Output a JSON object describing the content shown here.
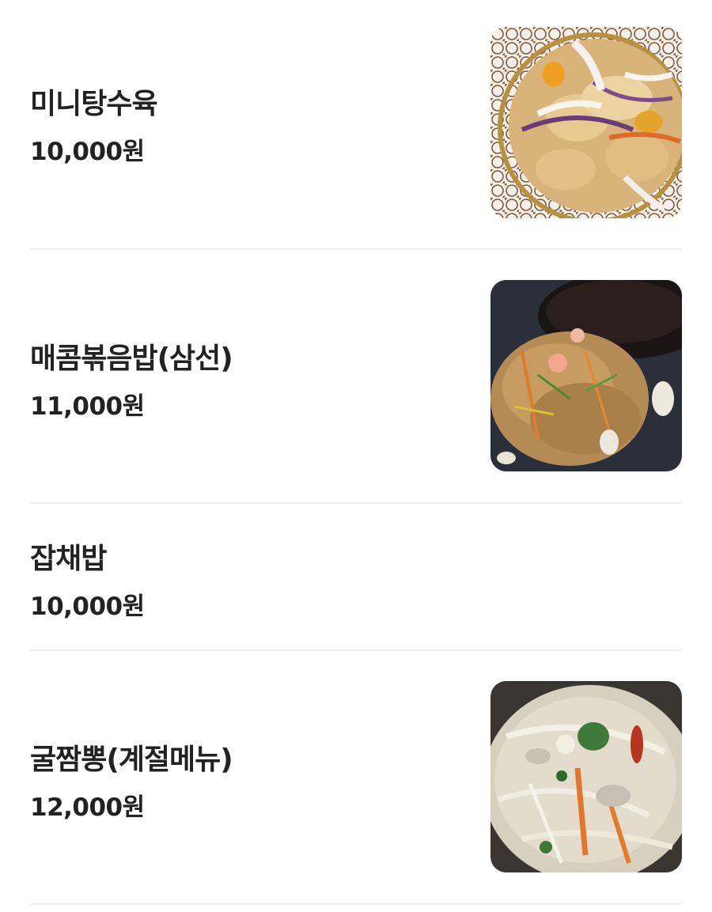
{
  "menu": {
    "items": [
      {
        "name": "미니탕수육",
        "price": "10,000원",
        "photo": "sweet-and-sour-pork-photo"
      },
      {
        "name": "매콤볶음밥(삼선)",
        "price": "11,000원",
        "photo": "spicy-fried-rice-photo"
      },
      {
        "name": "잡채밥",
        "price": "10,000원",
        "photo": null
      },
      {
        "name": "굴짬뽕(계절메뉴)",
        "price": "12,000원",
        "photo": "oyster-jjamppong-photo"
      }
    ]
  }
}
